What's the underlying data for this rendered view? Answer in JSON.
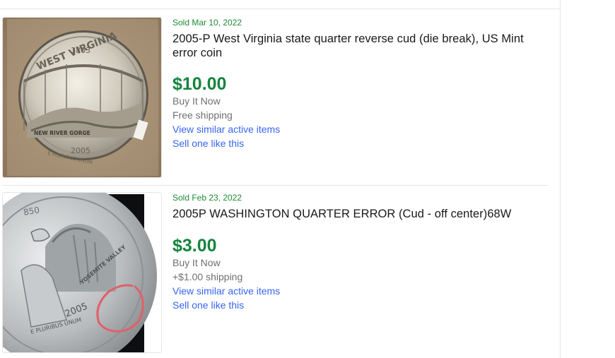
{
  "listings": [
    {
      "sold_date": "Sold Mar 10, 2022",
      "title": "2005-P West Virginia state quarter reverse cud (die break), US Mint error coin",
      "price": "$10.00",
      "format": "Buy It Now",
      "shipping": "Free shipping",
      "view_similar": "View similar active items",
      "sell_one": "Sell one like this",
      "image": {
        "icon": "coin-photo-west-virginia",
        "coin_top_text": "WEST VIRGINIA",
        "coin_year_top": "1863",
        "coin_bottom_text": "NEW RIVER GORGE",
        "coin_year": "2005",
        "coin_motto": "E PLURIBUS UNUM"
      }
    },
    {
      "sold_date": "Sold Feb 23, 2022",
      "title": "2005P WASHINGTON QUARTER ERROR (Cud - off center)68W",
      "price": "$3.00",
      "format": "Buy It Now",
      "shipping": "+$1.00 shipping",
      "view_similar": "View similar active items",
      "sell_one": "Sell one like this",
      "image": {
        "icon": "coin-photo-california",
        "coin_year": "2005",
        "coin_motto": "E PLURIBUS UNUM",
        "coin_side_text": "YOSEMITE VALLEY",
        "coin_top_num": "850"
      }
    }
  ],
  "colors": {
    "price": "#16843e",
    "sold": "#1e8a34",
    "link": "#3665f3",
    "secondary": "#707070"
  }
}
